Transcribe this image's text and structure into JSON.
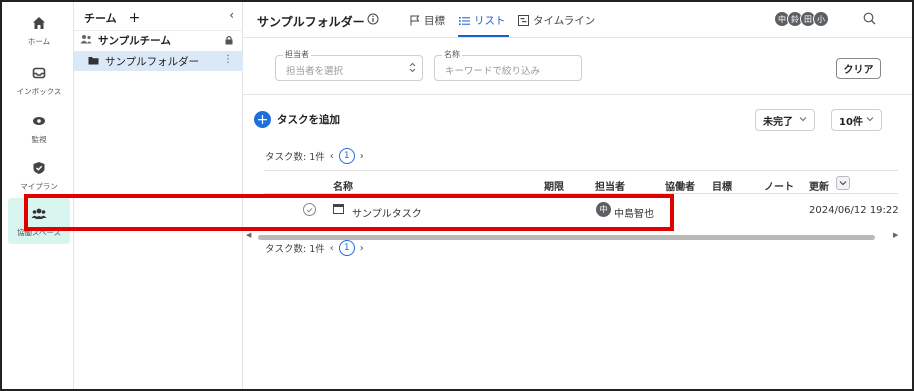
{
  "rail": {
    "items": [
      {
        "label": "ホーム",
        "icon": "home-icon"
      },
      {
        "label": "インボックス",
        "icon": "inbox-icon"
      },
      {
        "label": "監視",
        "icon": "eye-icon"
      },
      {
        "label": "マイプラン",
        "icon": "check-badge-icon"
      },
      {
        "label": "協働スペース",
        "icon": "people-icon",
        "active": true
      }
    ]
  },
  "tree": {
    "header": "チーム",
    "add": "+",
    "collapse": "‹",
    "team": {
      "label": "サンプルチーム",
      "icon": "people-icon"
    },
    "folder": {
      "label": "サンプルフォルダー",
      "icon": "folder-icon",
      "more": "⋮"
    }
  },
  "topbar": {
    "title": "サンプルフォルダー",
    "tabs": [
      {
        "label": "目標",
        "icon": "flag-icon"
      },
      {
        "label": "リスト",
        "icon": "list-icon",
        "active": true
      },
      {
        "label": "タイムライン",
        "icon": "timeline-icon"
      }
    ],
    "avatars": [
      "中",
      "鈴",
      "田",
      "小"
    ]
  },
  "filters": {
    "assignee": {
      "legend": "担当者",
      "placeholder": "担当者を選択"
    },
    "name": {
      "legend": "名称",
      "placeholder": "キーワードで絞り込み"
    },
    "clear": "クリア"
  },
  "actions": {
    "add_task": "タスクを追加",
    "status_filter": "未完了",
    "page_size": "10件"
  },
  "pager": {
    "count_label": "タスク数: 1件",
    "prev": "‹",
    "page": "1",
    "next": "›"
  },
  "table": {
    "columns": {
      "name": "名称",
      "due": "期限",
      "assignee": "担当者",
      "collaborators": "協働者",
      "goal": "目標",
      "note": "ノート",
      "updated": "更新"
    },
    "rows": [
      {
        "name": "サンプルタスク",
        "due": "",
        "assignee_initial": "中",
        "assignee": "中島智也",
        "collaborators": "",
        "goal": "",
        "note": "",
        "updated": "2024/06/12 19:22"
      }
    ]
  },
  "colors": {
    "accent": "#1a5fcc",
    "active_rail_bg": "#d9f5ef",
    "selected_folder_bg": "#dbe8f8",
    "highlight": "#e00000"
  }
}
